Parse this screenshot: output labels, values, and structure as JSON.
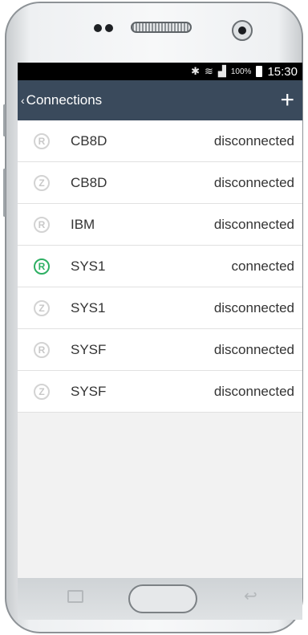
{
  "statusbar": {
    "icons": [
      "bluetooth-icon",
      "wifi-icon",
      "signal-icon"
    ],
    "battery": "100%",
    "time": "15:30"
  },
  "appbar": {
    "back_label": "Connections",
    "add_label": "+"
  },
  "connections": [
    {
      "badge": "R",
      "name": "CB8D",
      "status": "disconnected",
      "connected": false
    },
    {
      "badge": "Z",
      "name": "CB8D",
      "status": "disconnected",
      "connected": false
    },
    {
      "badge": "R",
      "name": "IBM",
      "status": "disconnected",
      "connected": false
    },
    {
      "badge": "R",
      "name": "SYS1",
      "status": "connected",
      "connected": true
    },
    {
      "badge": "Z",
      "name": "SYS1",
      "status": "disconnected",
      "connected": false
    },
    {
      "badge": "R",
      "name": "SYSF",
      "status": "disconnected",
      "connected": false
    },
    {
      "badge": "Z",
      "name": "SYSF",
      "status": "disconnected",
      "connected": false
    }
  ],
  "colors": {
    "appbar": "#3a4a5c",
    "connected_accent": "#2eaf63",
    "disconnected_badge": "#d3d3d3"
  }
}
